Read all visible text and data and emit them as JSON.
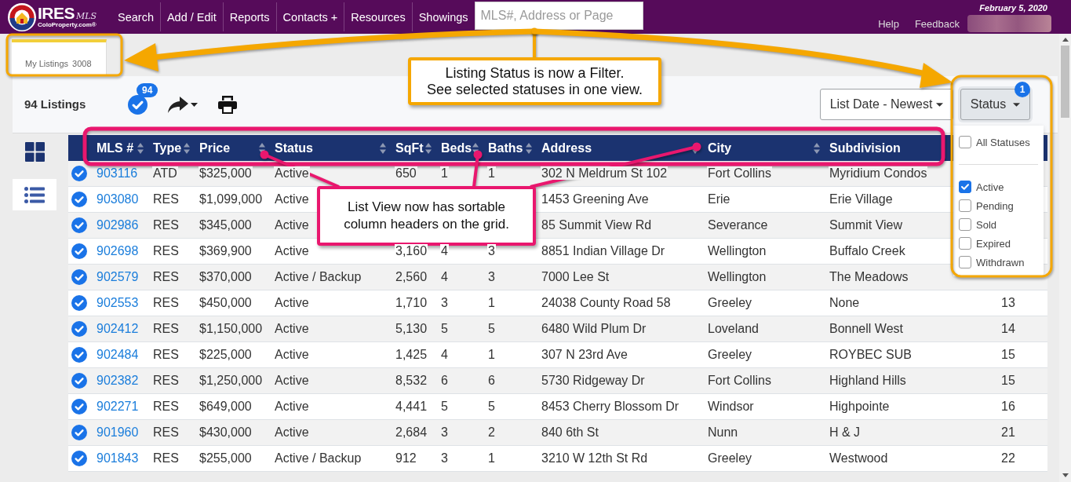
{
  "topbar": {
    "logo": {
      "name": "IRES",
      "suffix": "MLS",
      "tagline": "ColoProperty.com®"
    },
    "menu": [
      "Search",
      "Add / Edit",
      "Reports",
      "Contacts +",
      "Resources",
      "Showings"
    ],
    "search": {
      "placeholder": "MLS#, Address or Page"
    },
    "date": "February 5, 2020",
    "links": [
      "Help",
      "Feedback"
    ]
  },
  "tabs": [
    {
      "label": "My Listings",
      "count": "3008",
      "selected": true
    }
  ],
  "toolbar": {
    "title": "94 Listings",
    "selected_count": "94",
    "sort": {
      "label": "List Date - Newest"
    },
    "filter": {
      "label": "Status",
      "badge": "1",
      "expanded": true,
      "all_option": {
        "label": "All Statuses",
        "checked": false
      },
      "options": [
        {
          "label": "Active",
          "checked": true
        },
        {
          "label": "Pending",
          "checked": false
        },
        {
          "label": "Sold",
          "checked": false
        },
        {
          "label": "Expired",
          "checked": false
        },
        {
          "label": "Withdrawn",
          "checked": false
        }
      ]
    }
  },
  "views": [
    {
      "kind": "grid",
      "selected": false
    },
    {
      "kind": "list",
      "selected": true
    }
  ],
  "table": {
    "columns": [
      "MLS #",
      "Type",
      "Price",
      "Status",
      "SqFt",
      "Beds",
      "Baths",
      "Address",
      "City",
      "Subdivision"
    ],
    "rows": [
      {
        "selected": true,
        "mls": "903116",
        "type": "ATD",
        "price": "$325,000",
        "status": "Active",
        "sqft": "650",
        "beds": "1",
        "baths": "1",
        "address": "302 N Meldrum St 102",
        "city": "Fort Collins",
        "subdivision": "Myridium Condos"
      },
      {
        "selected": true,
        "mls": "903080",
        "type": "RES",
        "price": "$1,099,000",
        "status": "Active",
        "address": "1453 Greening Ave",
        "city": "Erie",
        "subdivision": "Erie Village"
      },
      {
        "selected": true,
        "mls": "902986",
        "type": "RES",
        "price": "$345,000",
        "status": "Active",
        "address": "85 Summit View Rd",
        "city": "Severance",
        "subdivision": "Summit View"
      },
      {
        "selected": true,
        "mls": "902698",
        "type": "RES",
        "price": "$369,900",
        "status": "Active",
        "sqft": "3,160",
        "beds": "4",
        "baths": "3",
        "address": "8851 Indian Village Dr",
        "city": "Wellington",
        "subdivision": "Buffalo Creek"
      },
      {
        "selected": true,
        "mls": "902579",
        "type": "RES",
        "price": "$370,000",
        "status": "Active / Backup",
        "sqft": "2,560",
        "beds": "4",
        "baths": "3",
        "address": "7000 Lee St",
        "city": "Wellington",
        "subdivision": "The Meadows"
      },
      {
        "selected": true,
        "mls": "902553",
        "type": "RES",
        "price": "$450,000",
        "status": "Active",
        "sqft": "1,710",
        "beds": "3",
        "baths": "1",
        "address": "24038 County Road 58",
        "city": "Greeley",
        "subdivision": "None",
        "column_11": "13"
      },
      {
        "selected": true,
        "mls": "902412",
        "type": "RES",
        "price": "$1,150,000",
        "status": "Active",
        "sqft": "5,130",
        "beds": "5",
        "baths": "5",
        "address": "6480 Wild Plum Dr",
        "city": "Loveland",
        "subdivision": "Bonnell West",
        "column_11": "14"
      },
      {
        "selected": true,
        "mls": "902484",
        "type": "RES",
        "price": "$225,000",
        "status": "Active",
        "sqft": "1,425",
        "beds": "4",
        "baths": "1",
        "address": "307 N 23rd Ave",
        "city": "Greeley",
        "subdivision": "ROYBEC SUB",
        "column_11": "15"
      },
      {
        "selected": true,
        "mls": "902382",
        "type": "RES",
        "price": "$1,250,000",
        "status": "Active",
        "sqft": "8,532",
        "beds": "6",
        "baths": "6",
        "address": "5730 Ridgeway Dr",
        "city": "Fort Collins",
        "subdivision": "Highland Hills",
        "column_11": "15"
      },
      {
        "selected": true,
        "mls": "902271",
        "type": "RES",
        "price": "$649,000",
        "status": "Active",
        "sqft": "4,441",
        "beds": "5",
        "baths": "5",
        "address": "8453 Cherry Blossom Dr",
        "city": "Windsor",
        "subdivision": "Highpointe",
        "column_11": "16"
      },
      {
        "selected": true,
        "mls": "901960",
        "type": "RES",
        "price": "$430,000",
        "status": "Active",
        "sqft": "2,684",
        "beds": "3",
        "baths": "2",
        "address": "840 6th St",
        "city": "Nunn",
        "subdivision": "H & J",
        "column_11": "21"
      },
      {
        "selected": true,
        "mls": "901843",
        "type": "RES",
        "price": "$255,000",
        "status": "Active / Backup",
        "sqft": "912",
        "beds": "3",
        "baths": "1",
        "address": "3210 W 12th St Rd",
        "city": "Greeley",
        "subdivision": "Westwood",
        "column_11": "22"
      }
    ]
  },
  "annotations": [
    {
      "kind": "arrow",
      "color": "#f5a700",
      "lines": [
        "Listing Status is now a Filter.",
        "See selected statuses in one view."
      ]
    },
    {
      "kind": "leader",
      "color": "#e9176e",
      "lines": [
        "List View now has sortable",
        "column headers on the grid."
      ]
    }
  ]
}
